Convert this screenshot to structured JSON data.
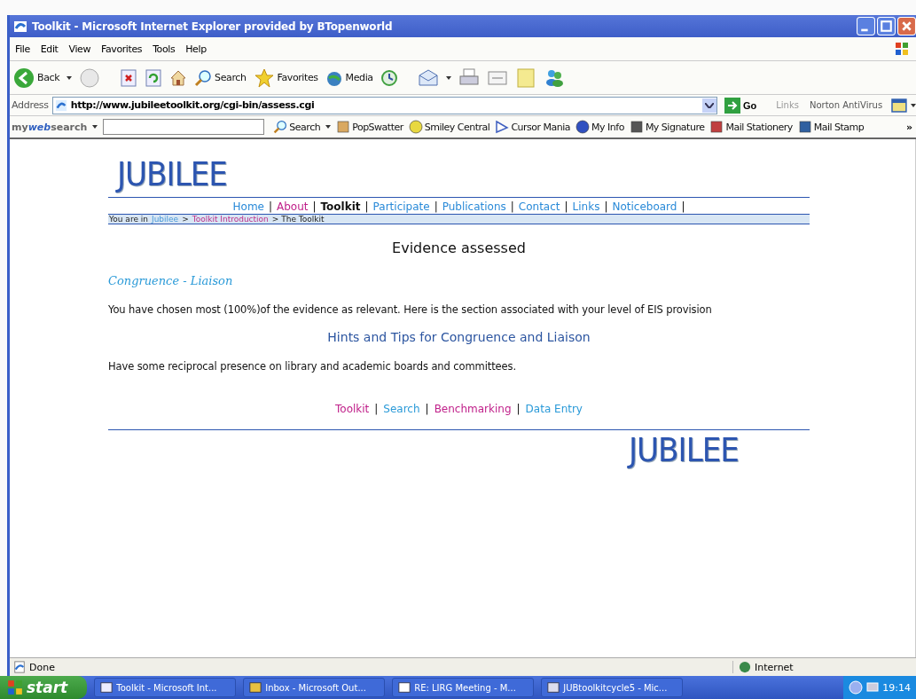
{
  "window": {
    "title": "Toolkit - Microsoft Internet Explorer provided by BTopenworld"
  },
  "menu": [
    "File",
    "Edit",
    "View",
    "Favorites",
    "Tools",
    "Help"
  ],
  "toolbar": {
    "back": "Back",
    "search": "Search",
    "favorites": "Favorites",
    "media": "Media"
  },
  "address": {
    "label": "Address",
    "value": "http://www.jubileetoolkit.org/cgi-bin/assess.cgi",
    "go": "Go",
    "links": "Links",
    "norton": "Norton AntiVirus"
  },
  "websearch": {
    "brand": [
      "my",
      "web",
      "search"
    ],
    "search": "Search",
    "items": [
      "PopSwatter",
      "Smiley Central",
      "Cursor Mania",
      "My Info",
      "My Signature",
      "Mail Stationery",
      "Mail Stamp"
    ],
    "more": "»"
  },
  "logo": "JUBILEE",
  "nav": [
    {
      "label": "Home",
      "selected": false,
      "visited": false,
      "separator": "|"
    },
    {
      "label": "About",
      "selected": false,
      "visited": true,
      "separator": "|"
    },
    {
      "label": "Toolkit",
      "selected": true,
      "separator": "|"
    },
    {
      "label": "Participate",
      "selected": false,
      "visited": false,
      "separator": "|"
    },
    {
      "label": "Publications",
      "selected": false,
      "visited": false,
      "separator": "|"
    },
    {
      "label": "Contact",
      "selected": false,
      "visited": false,
      "separator": "|"
    },
    {
      "label": "Links",
      "selected": false,
      "visited": false,
      "separator": "|"
    },
    {
      "label": "Noticeboard",
      "selected": false,
      "visited": false,
      "separator": "|"
    }
  ],
  "breadcrumb": {
    "prefix": "You are in",
    "items": [
      {
        "label": "Jubilee",
        "visited": false
      },
      {
        "separator": ">",
        "label": "Toolkit Introduction",
        "visited": true
      }
    ],
    "current": "> The Toolkit"
  },
  "heading": "Evidence assessed",
  "topic": "Congruence - Liaison",
  "message": "You have chosen most (100%)of the evidence as relevant. Here is the section associated with your level of EIS provision",
  "subheading": "Hints and Tips for Congruence and Liaison",
  "advice": "Have some reciprocal presence on library and academic boards and committees.",
  "footer_links": [
    {
      "label": "Toolkit",
      "visited": true
    },
    {
      "separator": "|",
      "label": "Search",
      "visited": false
    },
    {
      "separator": "|",
      "label": "Benchmarking",
      "visited": true
    },
    {
      "separator": "|",
      "label": "Data Entry",
      "visited": false
    }
  ],
  "footer_logo": "JUBILEE",
  "status_bar": {
    "text": "Done",
    "zone": "Internet"
  },
  "taskbar": {
    "start": "start",
    "tasks": [
      "Toolkit - Microsoft Int...",
      "Inbox - Microsoft Out...",
      "RE: LIRG Meeting - M...",
      "JUBtoolkitcycle5 - Mic..."
    ],
    "clock": "19:14"
  }
}
